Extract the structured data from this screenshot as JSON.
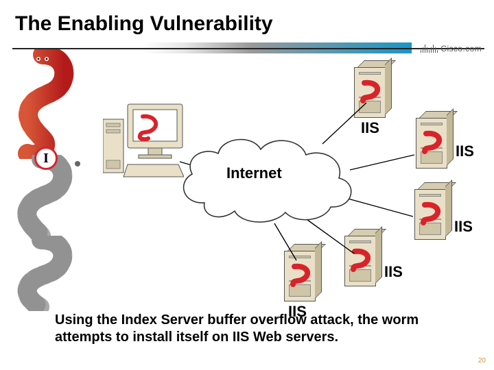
{
  "title": "The Enabling Vulnerability",
  "brand": "Cisco.com",
  "badge": {
    "letter": "I"
  },
  "cloud": {
    "label": "Internet"
  },
  "servers": {
    "top": "IIS",
    "right1": "IIS",
    "right2": "IIS",
    "bottom_right": "IIS",
    "bottom_left": "IIS"
  },
  "caption": "Using the Index Server buffer overflow attack, the worm attempts to install itself on IIS Web servers.",
  "page_number": "20"
}
